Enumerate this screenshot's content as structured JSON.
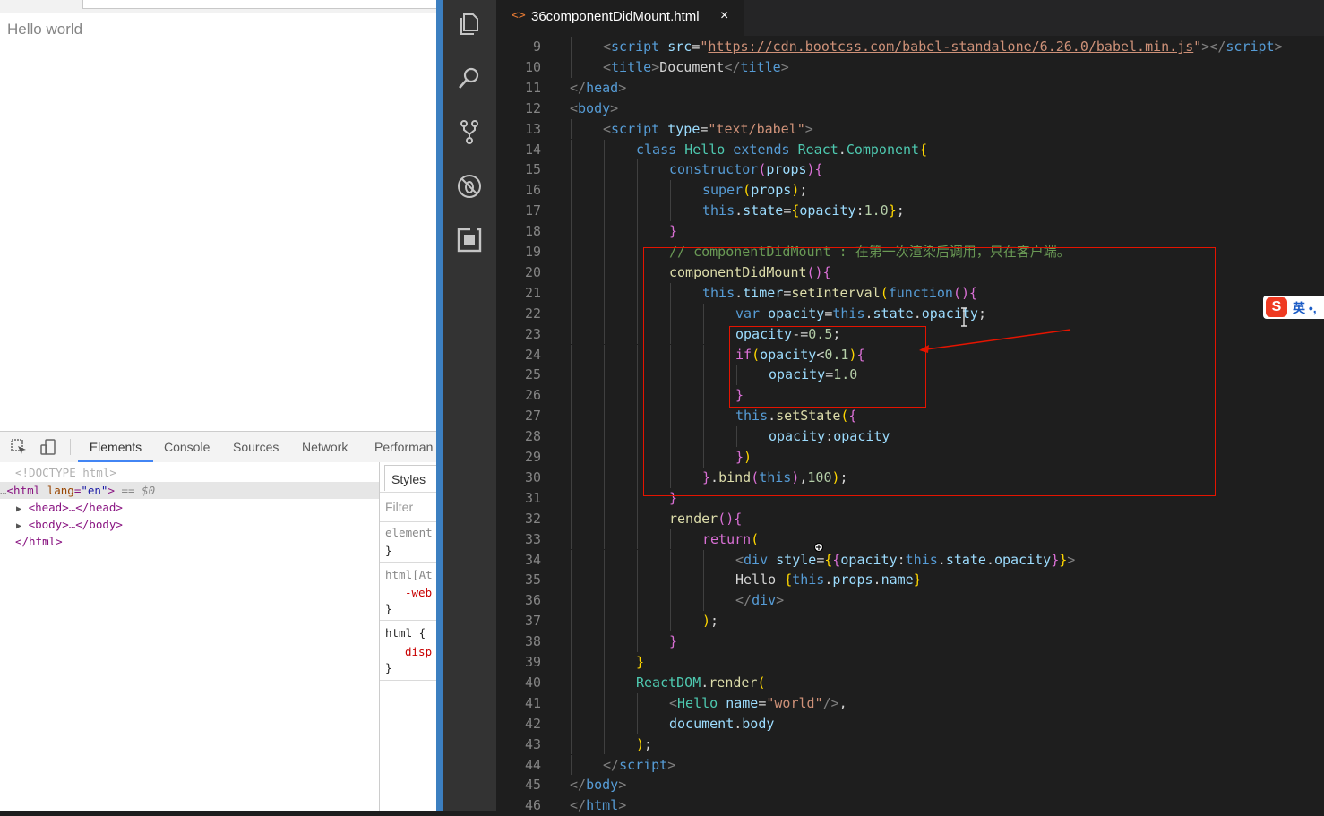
{
  "browser": {
    "page_text": "Hello world"
  },
  "devtools": {
    "tabs": [
      "Elements",
      "Console",
      "Sources",
      "Network",
      "Performan"
    ],
    "active_tab": "Elements",
    "dom": {
      "doctype": "<!DOCTYPE html>",
      "html_open_tag": "<html",
      "html_attr_name": "lang",
      "html_attr_value": "\"en\"",
      "selected_marker": "== $0",
      "head_collapsed": "<head>…</head>",
      "body_collapsed": "<body>…</body>",
      "html_close": "</html>"
    },
    "styles": {
      "tab_label": "Styles",
      "filter_placeholder": "Filter",
      "rules": [
        "element",
        "}",
        "html[At",
        "-web",
        "}",
        "html {",
        "disp",
        "}"
      ]
    }
  },
  "editor": {
    "tab_title": "36componentDidMount.html",
    "tab_icon": "<>",
    "close_glyph": "×",
    "activity_icons": [
      "explorer-icon",
      "search-icon",
      "source-control-icon",
      "debug-icon",
      "extensions-icon"
    ],
    "code_lines": [
      {
        "n": "9",
        "html": "<span class='pt'>&lt;</span><span class='k'>script</span> <span class='v'>src</span>=<span class='s'>\"</span><span class='link'>https://cdn.bootcss.com/babel-standalone/6.26.0/babel.min.js</span><span class='s'>\"</span><span class='pt'>&gt;&lt;/</span><span class='k'>script</span><span class='pt'>&gt;</span>",
        "indent": 1
      },
      {
        "n": "10",
        "html": "<span class='pt'>&lt;</span><span class='k'>title</span><span class='pt'>&gt;</span>Document<span class='pt'>&lt;/</span><span class='k'>title</span><span class='pt'>&gt;</span>",
        "indent": 1
      },
      {
        "n": "11",
        "html": "<span class='pt'>&lt;/</span><span class='k'>head</span><span class='pt'>&gt;</span>",
        "indent": 0
      },
      {
        "n": "12",
        "html": "<span class='pt'>&lt;</span><span class='k'>body</span><span class='pt'>&gt;</span>",
        "indent": 0
      },
      {
        "n": "13",
        "html": "<span class='pt'>&lt;</span><span class='k'>script</span> <span class='v'>type</span>=<span class='s'>\"text/babel\"</span><span class='pt'>&gt;</span>",
        "indent": 1
      },
      {
        "n": "14",
        "html": "<span class='k'>class</span> <span class='ty'>Hello</span> <span class='k'>extends</span> <span class='ty'>React</span>.<span class='ty'>Component</span><span class='b'>{</span>",
        "indent": 2
      },
      {
        "n": "15",
        "html": "<span class='k'>constructor</span><span class='pu'>(</span><span class='v'>props</span><span class='pu'>){</span>",
        "indent": 3
      },
      {
        "n": "16",
        "html": "<span class='k'>super</span><span class='b'>(</span><span class='v'>props</span><span class='b'>)</span>;",
        "indent": 4
      },
      {
        "n": "17",
        "html": "<span class='k'>this</span>.<span class='v'>state</span>=<span class='b'>{</span><span class='v'>opacity</span>:<span class='n'>1.0</span><span class='b'>}</span>;",
        "indent": 4
      },
      {
        "n": "18",
        "html": "<span class='pu'>}</span>",
        "indent": 3
      },
      {
        "n": "19",
        "html": "<span class='c'>// componentDidMount : 在第一次渲染后调用，只在客户端。</span>",
        "indent": 3
      },
      {
        "n": "20",
        "html": "<span class='f'>componentDidMount</span><span class='pu'>(){</span>",
        "indent": 3
      },
      {
        "n": "21",
        "html": "<span class='k'>this</span>.<span class='v'>timer</span>=<span class='f'>setInterval</span><span class='b'>(</span><span class='k'>function</span><span class='pu'>(){</span>",
        "indent": 4
      },
      {
        "n": "22",
        "html": "<span class='k'>var</span> <span class='v'>opacity</span>=<span class='k'>this</span>.<span class='v'>state</span>.<span class='v'>opacity</span>;",
        "indent": 5
      },
      {
        "n": "23",
        "html": "<span class='v'>opacity</span>-=<span class='n'>0.5</span>;",
        "indent": 5
      },
      {
        "n": "24",
        "html": "<span class='pu'>if</span><span class='b'>(</span><span class='v'>opacity</span>&lt;<span class='n'>0.1</span><span class='b'>)</span><span class='pu'>{</span>",
        "indent": 5
      },
      {
        "n": "25",
        "html": "<span class='v'>opacity</span>=<span class='n'>1.0</span>",
        "indent": 6
      },
      {
        "n": "26",
        "html": "<span class='pu'>}</span>",
        "indent": 5
      },
      {
        "n": "27",
        "html": "<span class='k'>this</span>.<span class='f'>setState</span><span class='b'>(</span><span class='pu'>{</span>",
        "indent": 5
      },
      {
        "n": "28",
        "html": "<span class='v'>opacity</span>:<span class='v'>opacity</span>",
        "indent": 6
      },
      {
        "n": "29",
        "html": "<span class='pu'>}</span><span class='b'>)</span>",
        "indent": 5
      },
      {
        "n": "30",
        "html": "<span class='pu'>}</span>.<span class='f'>bind</span><span class='pu'>(</span><span class='k'>this</span><span class='pu'>)</span>,<span class='n'>100</span><span class='b'>)</span>;",
        "indent": 4
      },
      {
        "n": "31",
        "html": "<span class='pu'>}</span>",
        "indent": 3
      },
      {
        "n": "32",
        "html": "<span class='f'>render</span><span class='pu'>(){</span>",
        "indent": 3
      },
      {
        "n": "33",
        "html": "<span class='pu'>return</span><span class='b'>(</span>",
        "indent": 4
      },
      {
        "n": "34",
        "html": "<span class='pt'>&lt;</span><span class='k'>div</span> <span class='v'>style</span>=<span class='b'>{</span><span class='pu'>{</span><span class='v'>opacity</span>:<span class='k'>this</span>.<span class='v'>state</span>.<span class='v'>opacity</span><span class='pu'>}</span><span class='b'>}</span><span class='pt'>&gt;</span>",
        "indent": 5
      },
      {
        "n": "35",
        "html": "Hello <span class='b'>{</span><span class='k'>this</span>.<span class='v'>props</span>.<span class='v'>name</span><span class='b'>}</span>",
        "indent": 5
      },
      {
        "n": "36",
        "html": "<span class='pt'>&lt;/</span><span class='k'>div</span><span class='pt'>&gt;</span>",
        "indent": 5
      },
      {
        "n": "37",
        "html": "<span class='b'>)</span>;",
        "indent": 4
      },
      {
        "n": "38",
        "html": "<span class='pu'>}</span>",
        "indent": 3
      },
      {
        "n": "39",
        "html": "<span class='b'>}</span>",
        "indent": 2
      },
      {
        "n": "40",
        "html": "<span class='ty'>ReactDOM</span>.<span class='f'>render</span><span class='b'>(</span>",
        "indent": 2
      },
      {
        "n": "41",
        "html": "<span class='pt'>&lt;</span><span class='ty'>Hello</span> <span class='v'>name</span>=<span class='s'>\"world\"</span><span class='pt'>/&gt;</span>,",
        "indent": 3
      },
      {
        "n": "42",
        "html": "<span class='v'>document</span>.<span class='v'>body</span>",
        "indent": 3
      },
      {
        "n": "43",
        "html": "<span class='b'>)</span>;",
        "indent": 2
      },
      {
        "n": "44",
        "html": "<span class='pt'>&lt;/</span><span class='k'>script</span><span class='pt'>&gt;</span>",
        "indent": 1
      },
      {
        "n": "45",
        "html": "<span class='pt'>&lt;/</span><span class='k'>body</span><span class='pt'>&gt;</span>",
        "indent": 0
      },
      {
        "n": "46",
        "html": "<span class='pt'>&lt;/</span><span class='k'>html</span><span class='pt'>&gt;</span>",
        "indent": 0
      }
    ]
  },
  "ime": {
    "label": "英 •,"
  },
  "colors": {
    "annotation_red": "#e51400",
    "editor_bg": "#1e1e1e",
    "activity_bg": "#333333",
    "tab_active_bg": "#1e1e1e"
  }
}
